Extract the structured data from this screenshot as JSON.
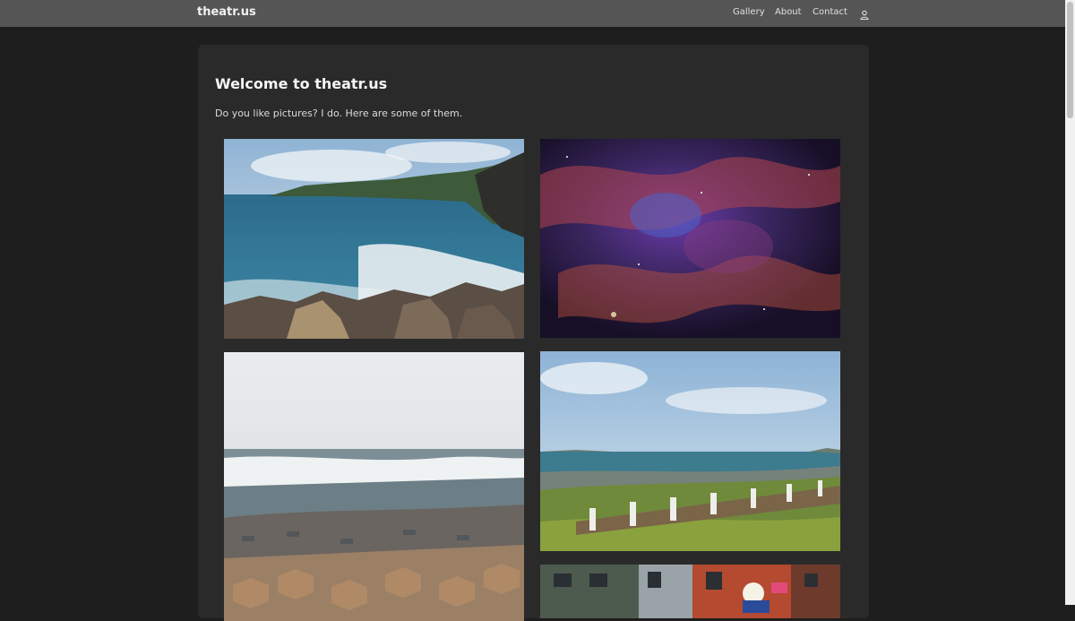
{
  "nav": {
    "brand": "theatr.us",
    "links": [
      {
        "label": "Gallery"
      },
      {
        "label": "About"
      },
      {
        "label": "Contact"
      }
    ],
    "user_icon": "user-icon"
  },
  "main": {
    "title": "Welcome to theatr.us",
    "intro": "Do you like pictures? I do. Here are some of them."
  },
  "gallery": {
    "photos": [
      {
        "subject": "coastal-cliffs-waves"
      },
      {
        "subject": "nebula"
      },
      {
        "subject": "basalt-columns-shore"
      },
      {
        "subject": "fence-by-sea"
      },
      {
        "subject": "city-street-neon"
      }
    ]
  },
  "colors": {
    "background": "#1e1e1e",
    "navbar": "#555555",
    "card": "#2a2a2a"
  }
}
